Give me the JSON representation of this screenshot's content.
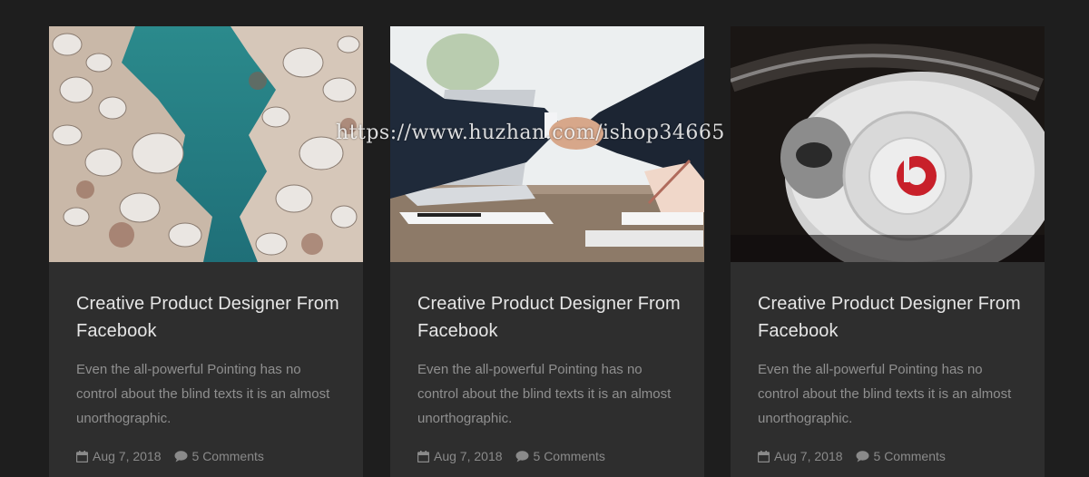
{
  "posts": [
    {
      "image": "aerial-rocky-coast",
      "title": "Creative Product Designer From Facebook",
      "excerpt": "Even the all-powerful Pointing has no control about the blind texts it is an almost unorthographic.",
      "date": "Aug 7, 2018",
      "comments": "5 Comments"
    },
    {
      "image": "business-handshake",
      "title": "Creative Product Designer From Facebook",
      "excerpt": "Even the all-powerful Pointing has no control about the blind texts it is an almost unorthographic.",
      "date": "Aug 7, 2018",
      "comments": "5 Comments"
    },
    {
      "image": "headphones",
      "title": "Creative Product Designer From Facebook",
      "excerpt": "Even the all-powerful Pointing has no control about the blind texts it is an almost unorthographic.",
      "date": "Aug 7, 2018",
      "comments": "5 Comments"
    }
  ],
  "watermark": "https://www.huzhan.com/ishop34665",
  "icons": {
    "date": "calendar-icon",
    "comments": "comment-bubble-icon"
  },
  "colors": {
    "background": "#1e1e1e",
    "card": "#2e2e2e",
    "title": "#e6e6e6",
    "text": "#8f8f8f",
    "beats_red": "#c8202a"
  }
}
